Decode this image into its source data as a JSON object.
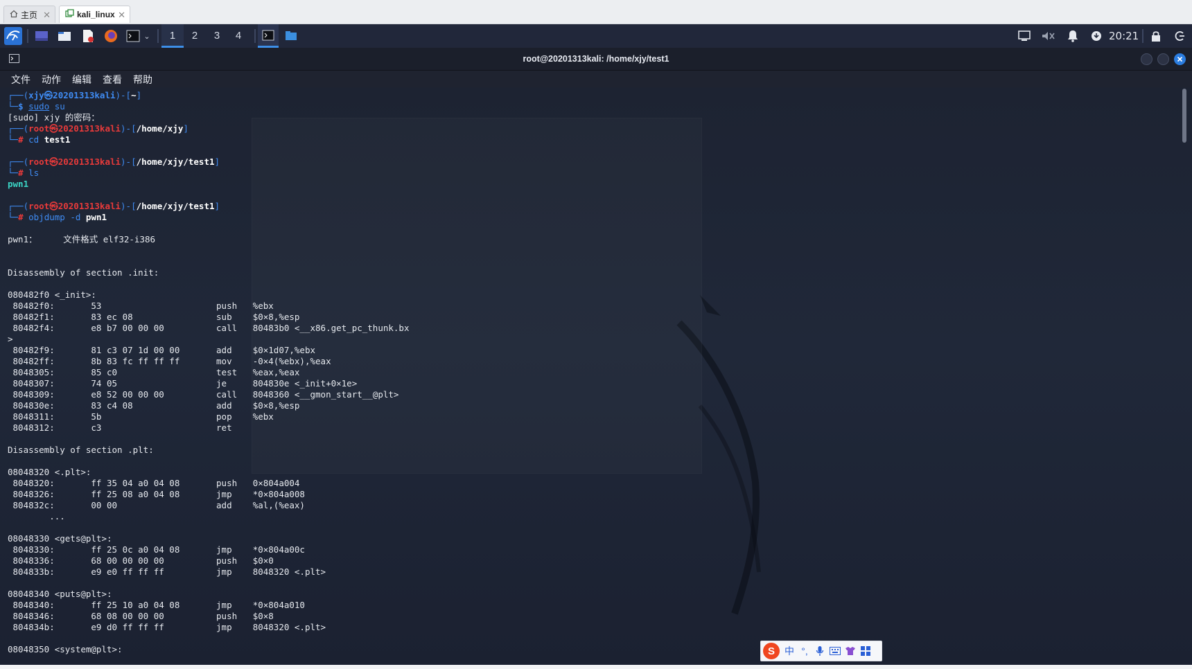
{
  "browser_tabs": [
    {
      "label": "主页",
      "icon": "home-icon"
    },
    {
      "label": "kali_linux",
      "icon": "vm-icon"
    }
  ],
  "taskbar": {
    "workspaces": [
      "1",
      "2",
      "3",
      "4"
    ],
    "active_workspace": "1",
    "clock": "20:21"
  },
  "window": {
    "title": "root@20201313kali: /home/xjy/test1"
  },
  "menu": [
    "文件",
    "动作",
    "编辑",
    "查看",
    "帮助"
  ],
  "colors": {
    "prompt_blue": "#3f8cf4",
    "root_red": "#e83a3a",
    "file_teal": "#3bd6c6",
    "taskbar_bg": "#21273a"
  },
  "terminal": {
    "lines": [
      [
        {
          "t": "┌──(",
          "c": "blue"
        },
        {
          "t": "xjy㉿20201313kali",
          "c": "blue",
          "b": true
        },
        {
          "t": ")-[",
          "c": "blue"
        },
        {
          "t": "~",
          "c": "white",
          "b": true
        },
        {
          "t": "]",
          "c": "blue"
        }
      ],
      [
        {
          "t": "└─",
          "c": "blue"
        },
        {
          "t": "$ ",
          "c": "blue",
          "b": true
        },
        {
          "t": "sudo",
          "c": "blue",
          "u": true
        },
        {
          "t": " su",
          "c": "blue"
        }
      ],
      [
        {
          "t": "[sudo] xjy 的密码：",
          "c": "grey"
        }
      ],
      [
        {
          "t": "┌──(",
          "c": "blue"
        },
        {
          "t": "root㉿20201313kali",
          "c": "red",
          "b": true
        },
        {
          "t": ")-[",
          "c": "blue"
        },
        {
          "t": "/home/xjy",
          "c": "white",
          "b": true
        },
        {
          "t": "]",
          "c": "blue"
        }
      ],
      [
        {
          "t": "└─",
          "c": "blue"
        },
        {
          "t": "# ",
          "c": "red",
          "b": true
        },
        {
          "t": "cd",
          "c": "blue"
        },
        {
          "t": " test1",
          "c": "white",
          "b": true
        }
      ],
      [
        {
          "t": "",
          "c": "grey"
        }
      ],
      [
        {
          "t": "┌──(",
          "c": "blue"
        },
        {
          "t": "root㉿20201313kali",
          "c": "red",
          "b": true
        },
        {
          "t": ")-[",
          "c": "blue"
        },
        {
          "t": "/home/xjy/test1",
          "c": "white",
          "b": true
        },
        {
          "t": "]",
          "c": "blue"
        }
      ],
      [
        {
          "t": "└─",
          "c": "blue"
        },
        {
          "t": "# ",
          "c": "red",
          "b": true
        },
        {
          "t": "ls",
          "c": "blue"
        }
      ],
      [
        {
          "t": "pwn1",
          "c": "teal",
          "b": true
        }
      ],
      [
        {
          "t": "",
          "c": "grey"
        }
      ],
      [
        {
          "t": "┌──(",
          "c": "blue"
        },
        {
          "t": "root㉿20201313kali",
          "c": "red",
          "b": true
        },
        {
          "t": ")-[",
          "c": "blue"
        },
        {
          "t": "/home/xjy/test1",
          "c": "white",
          "b": true
        },
        {
          "t": "]",
          "c": "blue"
        }
      ],
      [
        {
          "t": "└─",
          "c": "blue"
        },
        {
          "t": "# ",
          "c": "red",
          "b": true
        },
        {
          "t": "objdump",
          "c": "blue"
        },
        {
          "t": " -d ",
          "c": "blue"
        },
        {
          "t": "pwn1",
          "c": "white",
          "b": true
        }
      ],
      [
        {
          "t": "",
          "c": "grey"
        }
      ],
      [
        {
          "t": "pwn1：     文件格式 elf32-i386",
          "c": "grey"
        }
      ],
      [
        {
          "t": "",
          "c": "grey"
        }
      ],
      [
        {
          "t": "",
          "c": "grey"
        }
      ],
      [
        {
          "t": "Disassembly of section .init:",
          "c": "grey"
        }
      ],
      [
        {
          "t": "",
          "c": "grey"
        }
      ],
      [
        {
          "t": "080482f0 <_init>:",
          "c": "grey"
        }
      ],
      [
        {
          "t": " 80482f0:\t53                   \tpush   %ebx",
          "c": "grey"
        }
      ],
      [
        {
          "t": " 80482f1:\t83 ec 08             \tsub    $0×8,%esp",
          "c": "grey"
        }
      ],
      [
        {
          "t": " 80482f4:\te8 b7 00 00 00       \tcall   80483b0 <__x86.get_pc_thunk.bx",
          "c": "grey"
        }
      ],
      [
        {
          "t": ">",
          "c": "grey"
        }
      ],
      [
        {
          "t": " 80482f9:\t81 c3 07 1d 00 00    \tadd    $0×1d07,%ebx",
          "c": "grey"
        }
      ],
      [
        {
          "t": " 80482ff:\t8b 83 fc ff ff ff    \tmov    -0×4(%ebx),%eax",
          "c": "grey"
        }
      ],
      [
        {
          "t": " 8048305:\t85 c0                \ttest   %eax,%eax",
          "c": "grey"
        }
      ],
      [
        {
          "t": " 8048307:\t74 05                \tje     804830e <_init+0×1e>",
          "c": "grey"
        }
      ],
      [
        {
          "t": " 8048309:\te8 52 00 00 00       \tcall   8048360 <__gmon_start__@plt>",
          "c": "grey"
        }
      ],
      [
        {
          "t": " 804830e:\t83 c4 08             \tadd    $0×8,%esp",
          "c": "grey"
        }
      ],
      [
        {
          "t": " 8048311:\t5b                   \tpop    %ebx",
          "c": "grey"
        }
      ],
      [
        {
          "t": " 8048312:\tc3                   \tret",
          "c": "grey"
        }
      ],
      [
        {
          "t": "",
          "c": "grey"
        }
      ],
      [
        {
          "t": "Disassembly of section .plt:",
          "c": "grey"
        }
      ],
      [
        {
          "t": "",
          "c": "grey"
        }
      ],
      [
        {
          "t": "08048320 <.plt>:",
          "c": "grey"
        }
      ],
      [
        {
          "t": " 8048320:\tff 35 04 a0 04 08    \tpush   0×804a004",
          "c": "grey"
        }
      ],
      [
        {
          "t": " 8048326:\tff 25 08 a0 04 08    \tjmp    *0×804a008",
          "c": "grey"
        }
      ],
      [
        {
          "t": " 804832c:\t00 00                \tadd    %al,(%eax)",
          "c": "grey"
        }
      ],
      [
        {
          "t": "\t...",
          "c": "grey"
        }
      ],
      [
        {
          "t": "",
          "c": "grey"
        }
      ],
      [
        {
          "t": "08048330 <gets@plt>:",
          "c": "grey"
        }
      ],
      [
        {
          "t": " 8048330:\tff 25 0c a0 04 08    \tjmp    *0×804a00c",
          "c": "grey"
        }
      ],
      [
        {
          "t": " 8048336:\t68 00 00 00 00       \tpush   $0×0",
          "c": "grey"
        }
      ],
      [
        {
          "t": " 804833b:\te9 e0 ff ff ff       \tjmp    8048320 <.plt>",
          "c": "grey"
        }
      ],
      [
        {
          "t": "",
          "c": "grey"
        }
      ],
      [
        {
          "t": "08048340 <puts@plt>:",
          "c": "grey"
        }
      ],
      [
        {
          "t": " 8048340:\tff 25 10 a0 04 08    \tjmp    *0×804a010",
          "c": "grey"
        }
      ],
      [
        {
          "t": " 8048346:\t68 08 00 00 00       \tpush   $0×8",
          "c": "grey"
        }
      ],
      [
        {
          "t": " 804834b:\te9 d0 ff ff ff       \tjmp    8048320 <.plt>",
          "c": "grey"
        }
      ],
      [
        {
          "t": "",
          "c": "grey"
        }
      ],
      [
        {
          "t": "08048350 <system@plt>:",
          "c": "grey"
        }
      ]
    ]
  },
  "ime": {
    "logo": "S",
    "lang": "中",
    "punct": "°,",
    "icons": [
      "mic-icon",
      "keyboard-icon",
      "skin-icon",
      "grid-icon"
    ]
  }
}
